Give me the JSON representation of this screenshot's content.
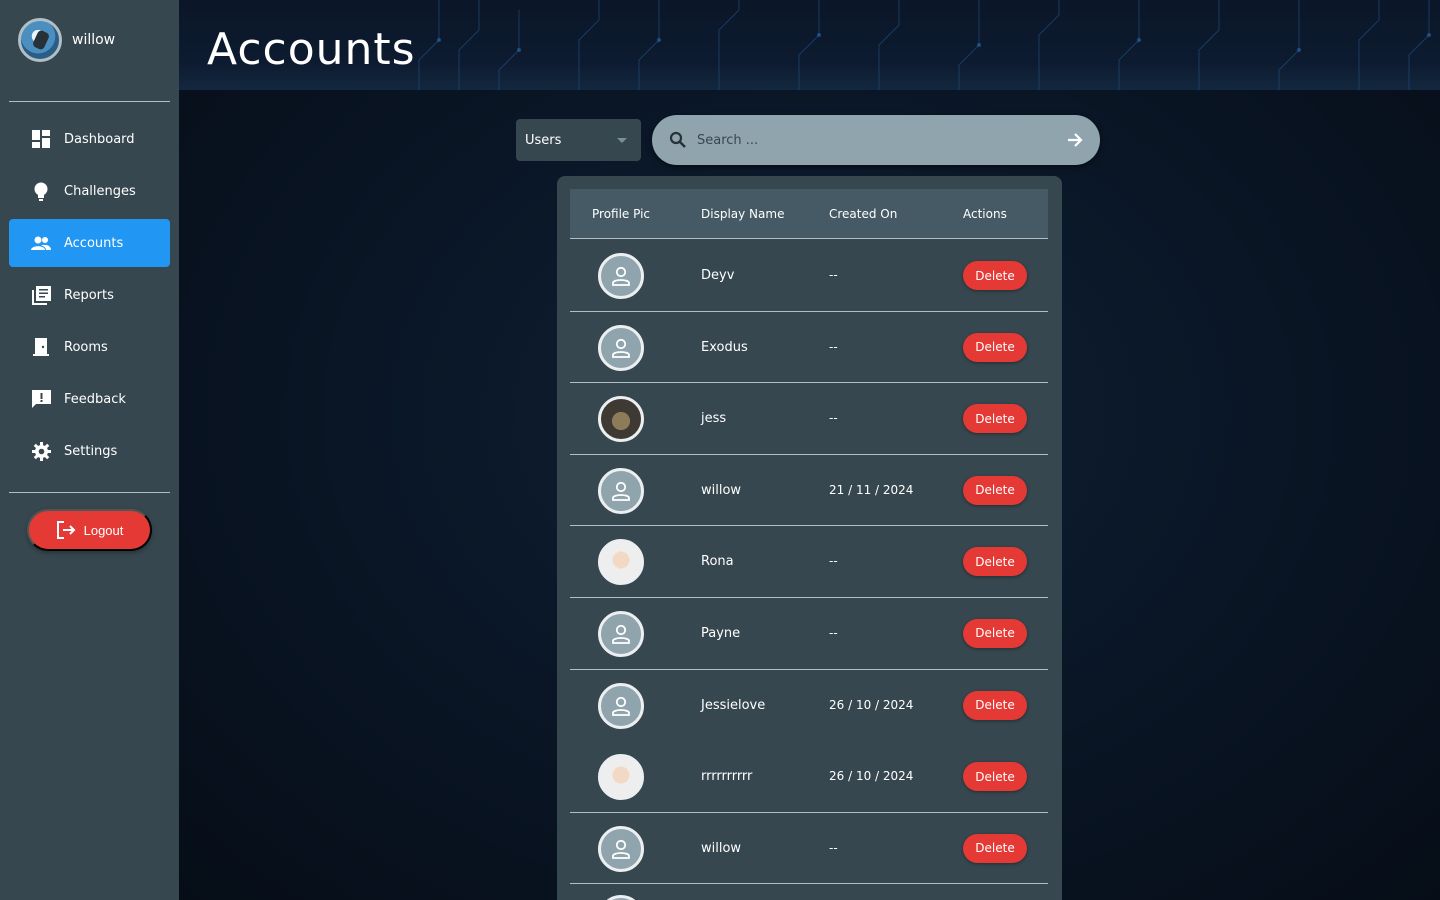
{
  "sidebar": {
    "username": "willow",
    "items": [
      {
        "label": "Dashboard",
        "icon": "dashboard-icon",
        "active": false
      },
      {
        "label": "Challenges",
        "icon": "lightbulb-icon",
        "active": false
      },
      {
        "label": "Accounts",
        "icon": "people-icon",
        "active": true
      },
      {
        "label": "Reports",
        "icon": "library-books-icon",
        "active": false
      },
      {
        "label": "Rooms",
        "icon": "door-icon",
        "active": false
      },
      {
        "label": "Feedback",
        "icon": "feedback-icon",
        "active": false
      },
      {
        "label": "Settings",
        "icon": "gear-icon",
        "active": false
      }
    ],
    "logout_label": "Logout"
  },
  "header": {
    "title": "Accounts"
  },
  "filters": {
    "type_selected": "Users",
    "search_placeholder": "Search ..."
  },
  "table": {
    "columns": [
      "Profile Pic",
      "Display Name",
      "Created On",
      "Actions"
    ],
    "action_label": "Delete",
    "rows": [
      {
        "name": "Deyv",
        "created": "--",
        "pic": "default-user-icon"
      },
      {
        "name": "Exodus",
        "created": "--",
        "pic": "default-user-icon"
      },
      {
        "name": "jess",
        "created": "--",
        "pic": "photo-avatar"
      },
      {
        "name": "willow",
        "created": "21 / 11 / 2024",
        "pic": "default-user-icon"
      },
      {
        "name": "Rona",
        "created": "--",
        "pic": "photo-avatar"
      },
      {
        "name": "Payne",
        "created": "--",
        "pic": "default-user-icon"
      },
      {
        "name": "Jessielove",
        "created": "26 / 10 / 2024",
        "pic": "default-user-icon"
      },
      {
        "name": "rrrrrrrrrr",
        "created": "26 / 10 / 2024",
        "pic": "photo-avatar"
      },
      {
        "name": "willow",
        "created": "--",
        "pic": "default-user-icon"
      }
    ]
  },
  "colors": {
    "sidebar_bg": "#37474f",
    "active_nav": "#2196f3",
    "danger": "#e53935",
    "search_bg": "#90a4ae"
  }
}
